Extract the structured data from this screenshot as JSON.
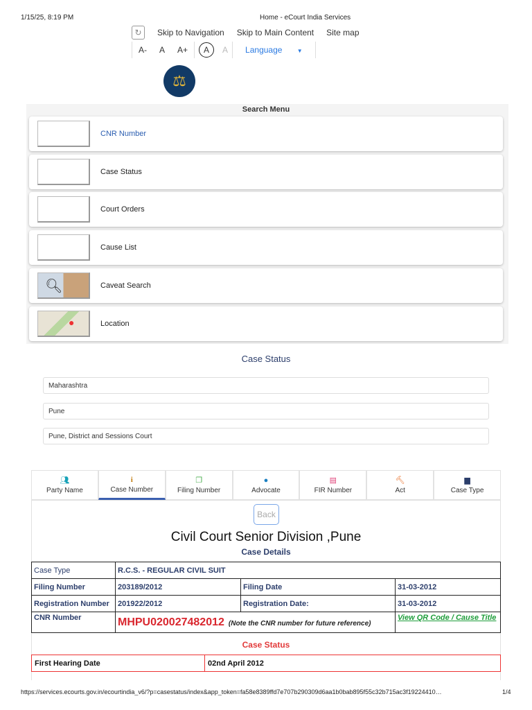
{
  "print_header": {
    "datetime": "1/15/25, 8:19 PM",
    "title": "Home - eCourt India Services"
  },
  "topnav": {
    "skip_nav": "Skip to Navigation",
    "skip_main": "Skip to Main Content",
    "site_map": "Site map"
  },
  "fontbar": {
    "decrease": "A-",
    "normal": "A",
    "increase": "A+",
    "contrast_dark": "A",
    "contrast_light": "A",
    "language": "Language"
  },
  "search_menu": {
    "title": "Search Menu",
    "items": [
      {
        "label": "CNR Number"
      },
      {
        "label": "Case Status"
      },
      {
        "label": "Court Orders"
      },
      {
        "label": "Cause List"
      },
      {
        "label": "Caveat Search"
      },
      {
        "label": "Location"
      }
    ]
  },
  "case_status": {
    "title": "Case Status",
    "state": "Maharashtra",
    "district": "Pune",
    "court_complex": "Pune, District and Sessions Court"
  },
  "tabs": [
    {
      "label": "Party Name",
      "color": "#17a2b8"
    },
    {
      "label": "Case Number",
      "color": "#c27c0e"
    },
    {
      "label": "Filing Number",
      "color": "#4caf50"
    },
    {
      "label": "Advocate",
      "color": "#1a7fc1"
    },
    {
      "label": "FIR Number",
      "color": "#e0457b"
    },
    {
      "label": "Act",
      "color": "#e8671c"
    },
    {
      "label": "Case Type",
      "color": "#2c3e6b"
    }
  ],
  "result": {
    "back_label": "Back",
    "court_title": "Civil Court Senior Division ,Pune",
    "details_title": "Case Details",
    "case_type_label": "Case Type",
    "case_type": "R.C.S. - REGULAR CIVIL SUIT",
    "filing_number_label": "Filing Number",
    "filing_number": "203189/2012",
    "filing_date_label": "Filing Date",
    "filing_date": "31-03-2012",
    "reg_number_label": "Registration Number",
    "reg_number": "201922/2012",
    "reg_date_label": "Registration Date:",
    "reg_date": "31-03-2012",
    "cnr_label": "CNR Number",
    "cnr": "MHPU020027482012",
    "cnr_note": "(Note the CNR number for future reference)",
    "qr_link": "View QR Code / Cause Title",
    "status_title": "Case Status",
    "first_hearing_label": "First Hearing Date",
    "first_hearing": "02nd April 2012"
  },
  "print_footer": {
    "url": "https://services.ecourts.gov.in/ecourtindia_v6/?p=casestatus/index&app_token=fa58e8389ffd7e707b290309d6aa1b0bab895f55c32b715ac3f19224410…",
    "page": "1/4"
  }
}
